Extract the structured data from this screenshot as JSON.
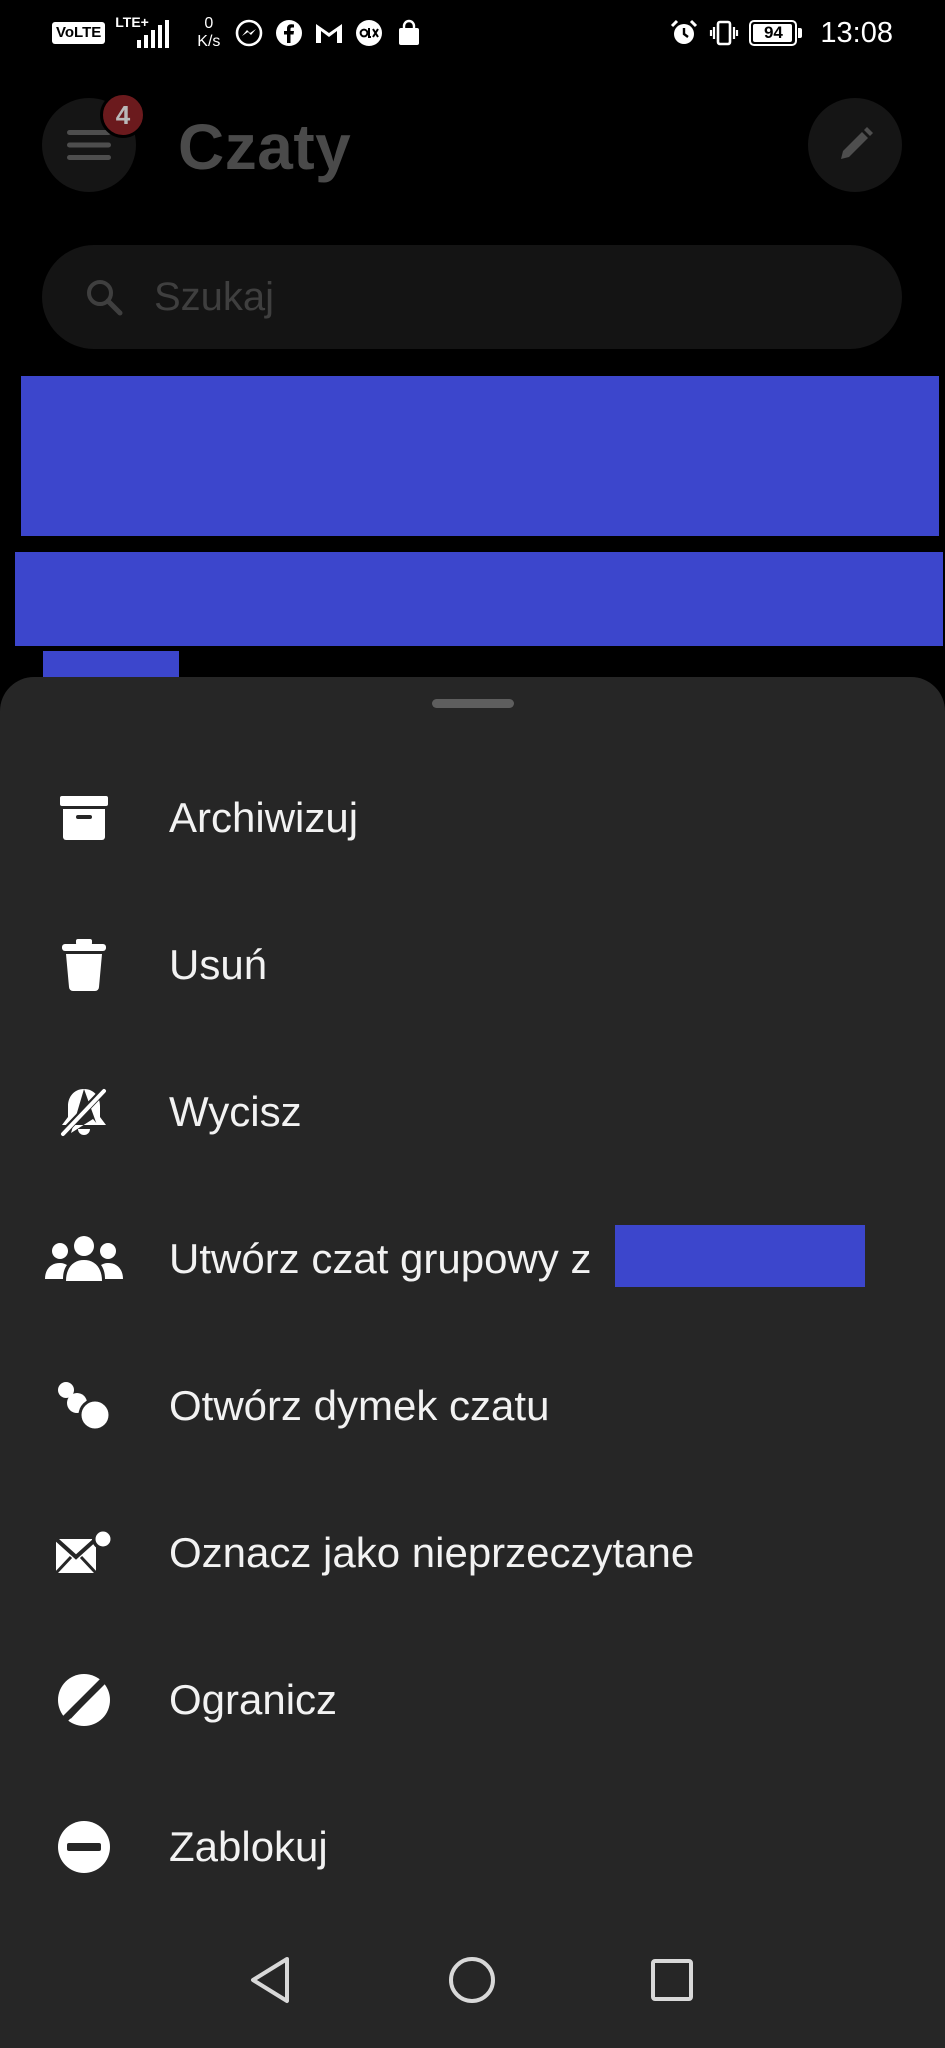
{
  "status_bar": {
    "volte": "VoLTE",
    "network": "LTE+",
    "speed_value": "0",
    "speed_unit": "K/s",
    "battery": "94",
    "time": "13:08"
  },
  "header": {
    "title": "Czaty",
    "badge_count": "4"
  },
  "search": {
    "placeholder": "Szukaj"
  },
  "context_menu": {
    "items": [
      {
        "label": "Archiwizuj",
        "icon": "archive-icon"
      },
      {
        "label": "Usuń",
        "icon": "trash-icon"
      },
      {
        "label": "Wycisz",
        "icon": "bell-off-icon"
      },
      {
        "label": "Utwórz czat grupowy z",
        "icon": "group-icon"
      },
      {
        "label": "Otwórz dymek czatu",
        "icon": "chat-bubbles-icon"
      },
      {
        "label": "Oznacz jako nieprzeczytane",
        "icon": "mail-unread-icon"
      },
      {
        "label": "Ogranicz",
        "icon": "restrict-icon"
      },
      {
        "label": "Zablokuj",
        "icon": "block-icon"
      }
    ]
  },
  "colors": {
    "background": "#000000",
    "sheet": "#262626",
    "redaction": "#3c46cc",
    "badge": "#6b1a1d"
  }
}
